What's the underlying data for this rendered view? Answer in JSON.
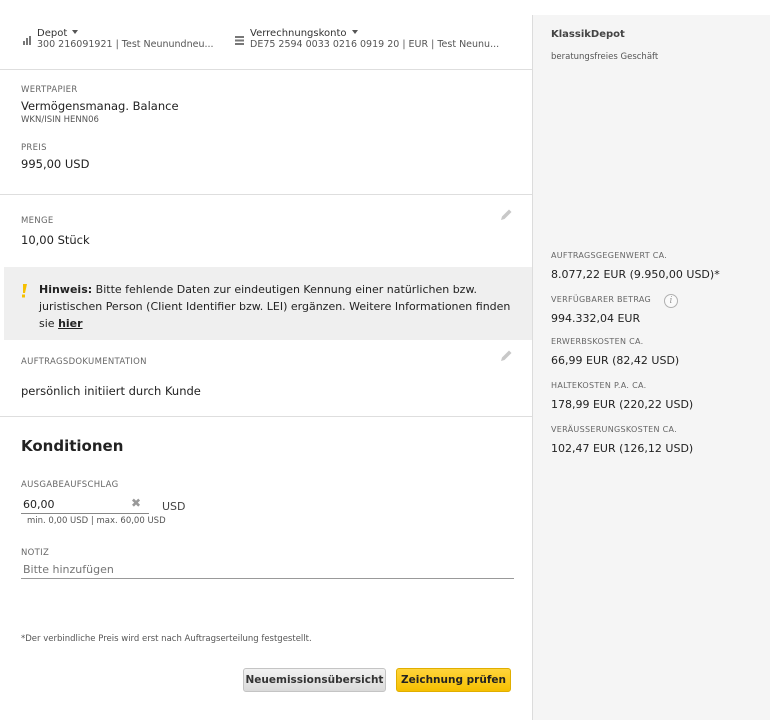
{
  "header": {
    "depot": {
      "label": "Depot",
      "value": "300 216091921 | Test Neunundneu..."
    },
    "konto": {
      "label": "Verrechnungskonto",
      "value": "DE75 2594 0033 0216 0919 20 | EUR | Test Neunu..."
    }
  },
  "wertpapier": {
    "label": "WERTPAPIER",
    "name": "Vermögensmanag. Balance",
    "wkn": "WKN/ISIN  HENN06",
    "preis_label": "PREIS",
    "preis_value": "995,00 USD"
  },
  "menge": {
    "label": "MENGE",
    "value": "10,00 Stück"
  },
  "hinweis": {
    "title": "Hinweis:",
    "text": " Bitte fehlende Daten zur eindeutigen Kennung einer natürlichen bzw. juristischen Person (CIient Identifier bzw. LEI) ergänzen. Weitere Informationen finden sie ",
    "link": "hier"
  },
  "dokumentation": {
    "label": "AUFTRAGSDOKUMENTATION",
    "value": "persönlich initiiert durch Kunde"
  },
  "konditionen": {
    "title": "Konditionen",
    "ausgabe_label": "AUSGABEAUFSCHLAG",
    "ausgabe_value": "60,00",
    "ausgabe_unit": "USD",
    "ausgabe_range": "min. 0,00 USD | max. 60,00 USD",
    "notiz_label": "NOTIZ",
    "notiz_placeholder": "Bitte hinzufügen"
  },
  "footnote": "*Der verbindliche Preis wird erst nach Auftragserteilung festgestellt.",
  "buttons": {
    "overview": "Neuemissionsübersicht",
    "check": "Zeichnung prüfen"
  },
  "sidebar": {
    "title": "KlassikDepot",
    "subtitle": "beratungsfreies Geschäft",
    "items": [
      {
        "label": "AUFTRAGSGEGENWERT CA.",
        "value": "8.077,22 EUR (9.950,00 USD)*"
      },
      {
        "label": "VERFÜGBARER BETRAG",
        "value": "994.332,04 EUR"
      },
      {
        "label": "ERWERBSKOSTEN CA.",
        "value": "66,99 EUR (82,42 USD)"
      },
      {
        "label": "HALTEKOSTEN P.A. CA.",
        "value": "178,99 EUR (220,22 USD)"
      },
      {
        "label": "VERÄUSSERUNGSKOSTEN CA.",
        "value": "102,47 EUR (126,12 USD)"
      }
    ]
  },
  "colors": {
    "accent": "#f6c000",
    "hint_bg": "#efefef",
    "sidebar_bg": "#f5f5f5"
  },
  "icons": {
    "depot": "bar-chart-icon",
    "konto": "account-list-icon",
    "hint": "exclamation-icon",
    "edit": "pencil-icon",
    "clear": "clear-x-icon",
    "info": "info-icon"
  }
}
